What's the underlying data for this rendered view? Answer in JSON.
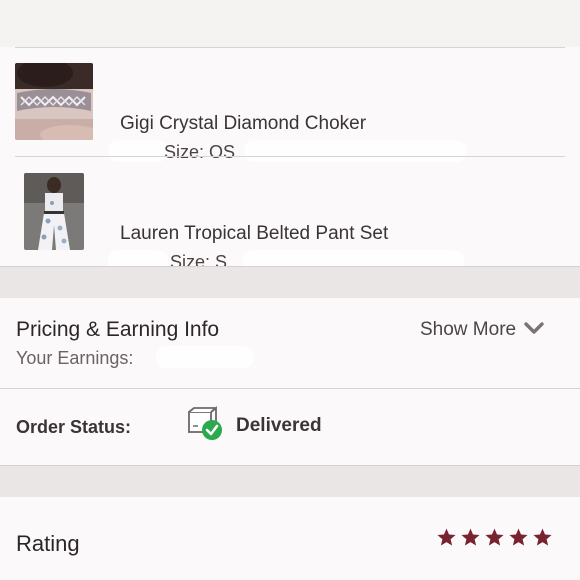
{
  "order_items": [
    {
      "name": "Gigi Crystal Diamond Choker",
      "size": "Size: OS",
      "thumb": "choker-photo"
    },
    {
      "name": "Lauren Tropical Belted Pant Set",
      "size": "Size: S",
      "thumb": "pant-set-photo"
    }
  ],
  "pricing": {
    "title": "Pricing & Earning Info",
    "earnings_label": "Your Earnings:",
    "show_more_label": "Show More",
    "show_more_icon": "chevron-down-icon"
  },
  "order_status": {
    "label": "Order Status:",
    "value": "Delivered",
    "icon": "package-delivered-icon",
    "status_color": "#2aa94e"
  },
  "rating": {
    "label": "Rating",
    "stars": 5,
    "max": 5,
    "star_color": "#7a2330"
  }
}
